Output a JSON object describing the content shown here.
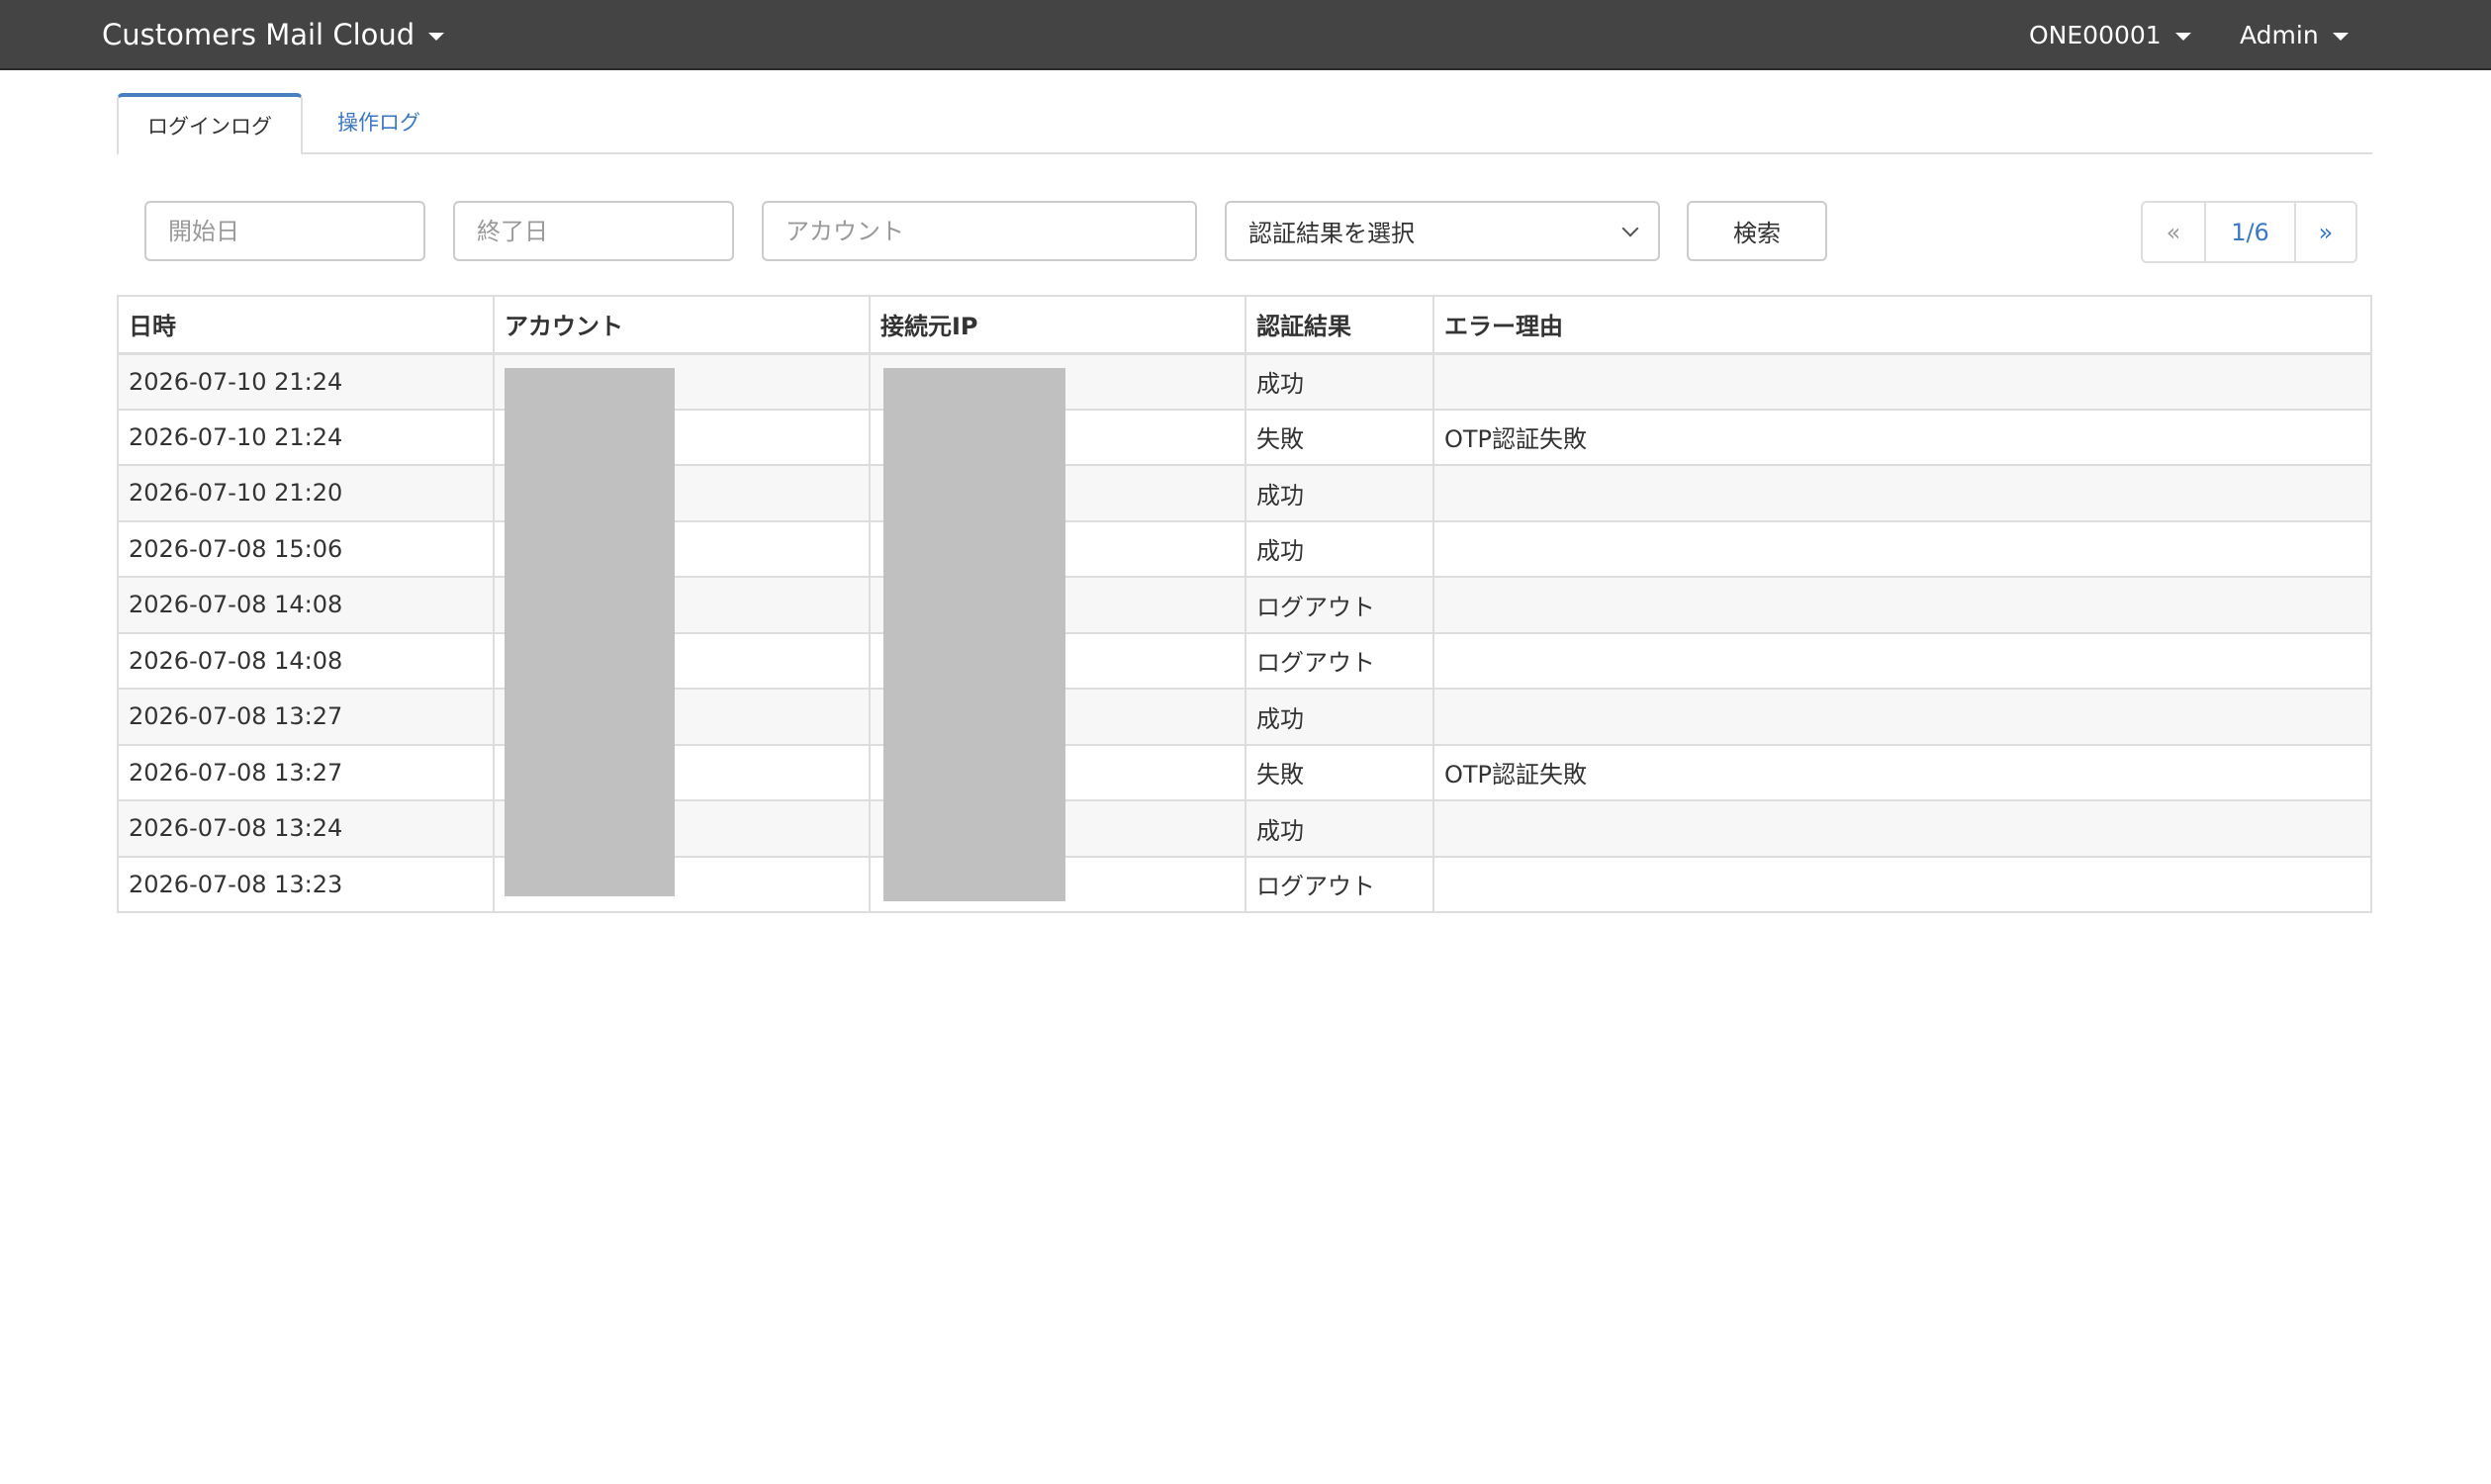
{
  "topbar": {
    "brand": "Customers Mail Cloud",
    "account": "ONE00001",
    "user": "Admin"
  },
  "tabs": [
    {
      "label": "ログインログ",
      "active": true
    },
    {
      "label": "操作ログ",
      "active": false
    }
  ],
  "filters": {
    "start_date_placeholder": "開始日",
    "end_date_placeholder": "終了日",
    "account_placeholder": "アカウント",
    "result_select": "認証結果を選択",
    "search_label": "検索"
  },
  "pager": {
    "prev": "«",
    "current": "1/6",
    "next": "»"
  },
  "table": {
    "headers": [
      "日時",
      "アカウント",
      "接続元IP",
      "認証結果",
      "エラー理由"
    ],
    "rows": [
      {
        "datetime": "2026-07-10 21:24",
        "result": "成功",
        "error": ""
      },
      {
        "datetime": "2026-07-10 21:24",
        "result": "失敗",
        "error": "OTP認証失敗"
      },
      {
        "datetime": "2026-07-10 21:20",
        "result": "成功",
        "error": ""
      },
      {
        "datetime": "2026-07-08 15:06",
        "result": "成功",
        "error": ""
      },
      {
        "datetime": "2026-07-08 14:08",
        "result": "ログアウト",
        "error": ""
      },
      {
        "datetime": "2026-07-08 14:08",
        "result": "ログアウト",
        "error": ""
      },
      {
        "datetime": "2026-07-08 13:27",
        "result": "成功",
        "error": ""
      },
      {
        "datetime": "2026-07-08 13:27",
        "result": "失敗",
        "error": "OTP認証失敗"
      },
      {
        "datetime": "2026-07-08 13:24",
        "result": "成功",
        "error": ""
      },
      {
        "datetime": "2026-07-08 13:23",
        "result": "ログアウト",
        "error": ""
      }
    ]
  },
  "colors": {
    "topbar": "#444444",
    "link": "#3a78c3",
    "active_tab_accent": "#4a7fc0",
    "redaction": "#c0c0c0"
  }
}
